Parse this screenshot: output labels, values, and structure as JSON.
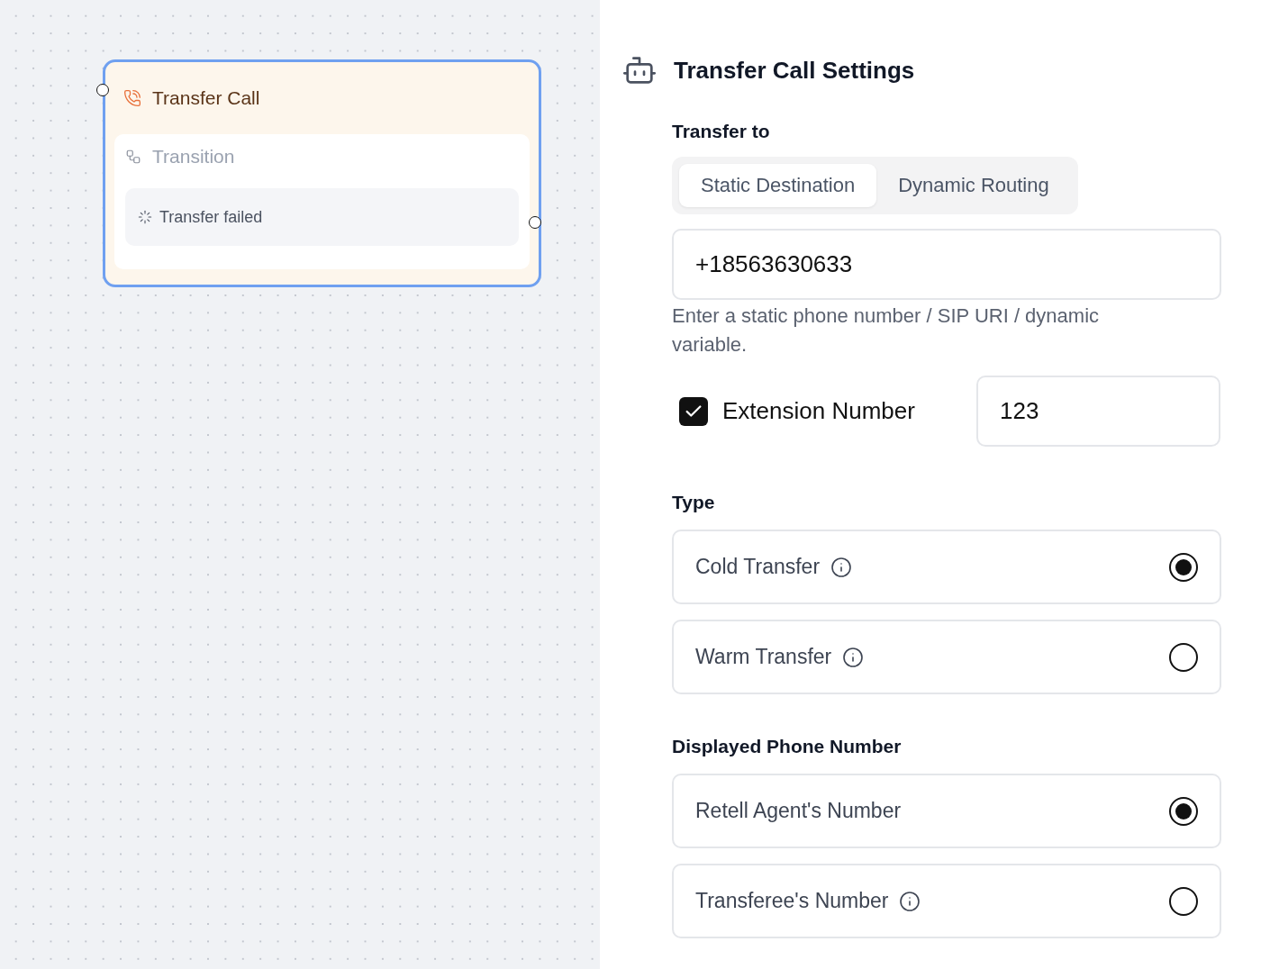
{
  "node": {
    "title": "Transfer Call",
    "section": "Transition",
    "transitions": [
      "Transfer failed"
    ],
    "selected": true
  },
  "settings": {
    "title": "Transfer Call Settings",
    "transfer_to": {
      "label": "Transfer to",
      "tabs": [
        {
          "label": "Static Destination",
          "selected": true
        },
        {
          "label": "Dynamic Routing",
          "selected": false
        }
      ],
      "value": "+18563630633",
      "help": "Enter a static phone number / SIP URI / dynamic variable.",
      "extension": {
        "label": "Extension Number",
        "checked": true,
        "value": "123"
      }
    },
    "type": {
      "label": "Type",
      "options": [
        {
          "label": "Cold Transfer",
          "info": true,
          "selected": true
        },
        {
          "label": "Warm Transfer",
          "info": true,
          "selected": false
        }
      ]
    },
    "displayed_number": {
      "label": "Displayed Phone Number",
      "options": [
        {
          "label": "Retell Agent's Number",
          "info": false,
          "selected": true
        },
        {
          "label": "Transferee's Number",
          "info": true,
          "selected": false
        }
      ]
    }
  }
}
